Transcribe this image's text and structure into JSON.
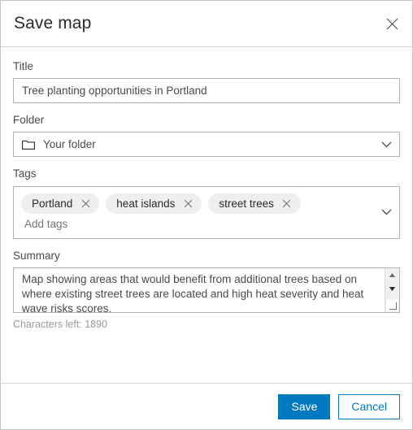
{
  "dialog": {
    "title": "Save map",
    "close_icon": "close-icon"
  },
  "form": {
    "title_field": {
      "label": "Title",
      "value": "Tree planting opportunities in Portland",
      "placeholder": "Title"
    },
    "folder_field": {
      "label": "Folder",
      "value": "Your folder",
      "icon": "folder-icon",
      "chevron_icon": "chevron-down-icon"
    },
    "tags_field": {
      "label": "Tags",
      "tags": [
        "Portland",
        "heat islands",
        "street trees"
      ],
      "remove_icon": "close-icon",
      "input_value": "",
      "placeholder": "Add tags",
      "chevron_icon": "chevron-down-icon"
    },
    "summary_field": {
      "label": "Summary",
      "value": "Map showing areas that would benefit from additional trees based on where existing street trees are located and high heat severity and heat wave risks scores.",
      "placeholder": "Summary",
      "characters_left": "Characters left: 1890",
      "scroll_up_icon": "triangle-up-icon",
      "scroll_down_icon": "triangle-down-icon",
      "resize_icon": "resize-grip-icon"
    }
  },
  "footer": {
    "save_label": "Save",
    "cancel_label": "Cancel"
  },
  "colors": {
    "accent": "#0079c1",
    "border": "#b3b3b3",
    "tag_background": "#efefef",
    "text": "#4a4a4a",
    "muted_text": "#9a9a9a"
  }
}
